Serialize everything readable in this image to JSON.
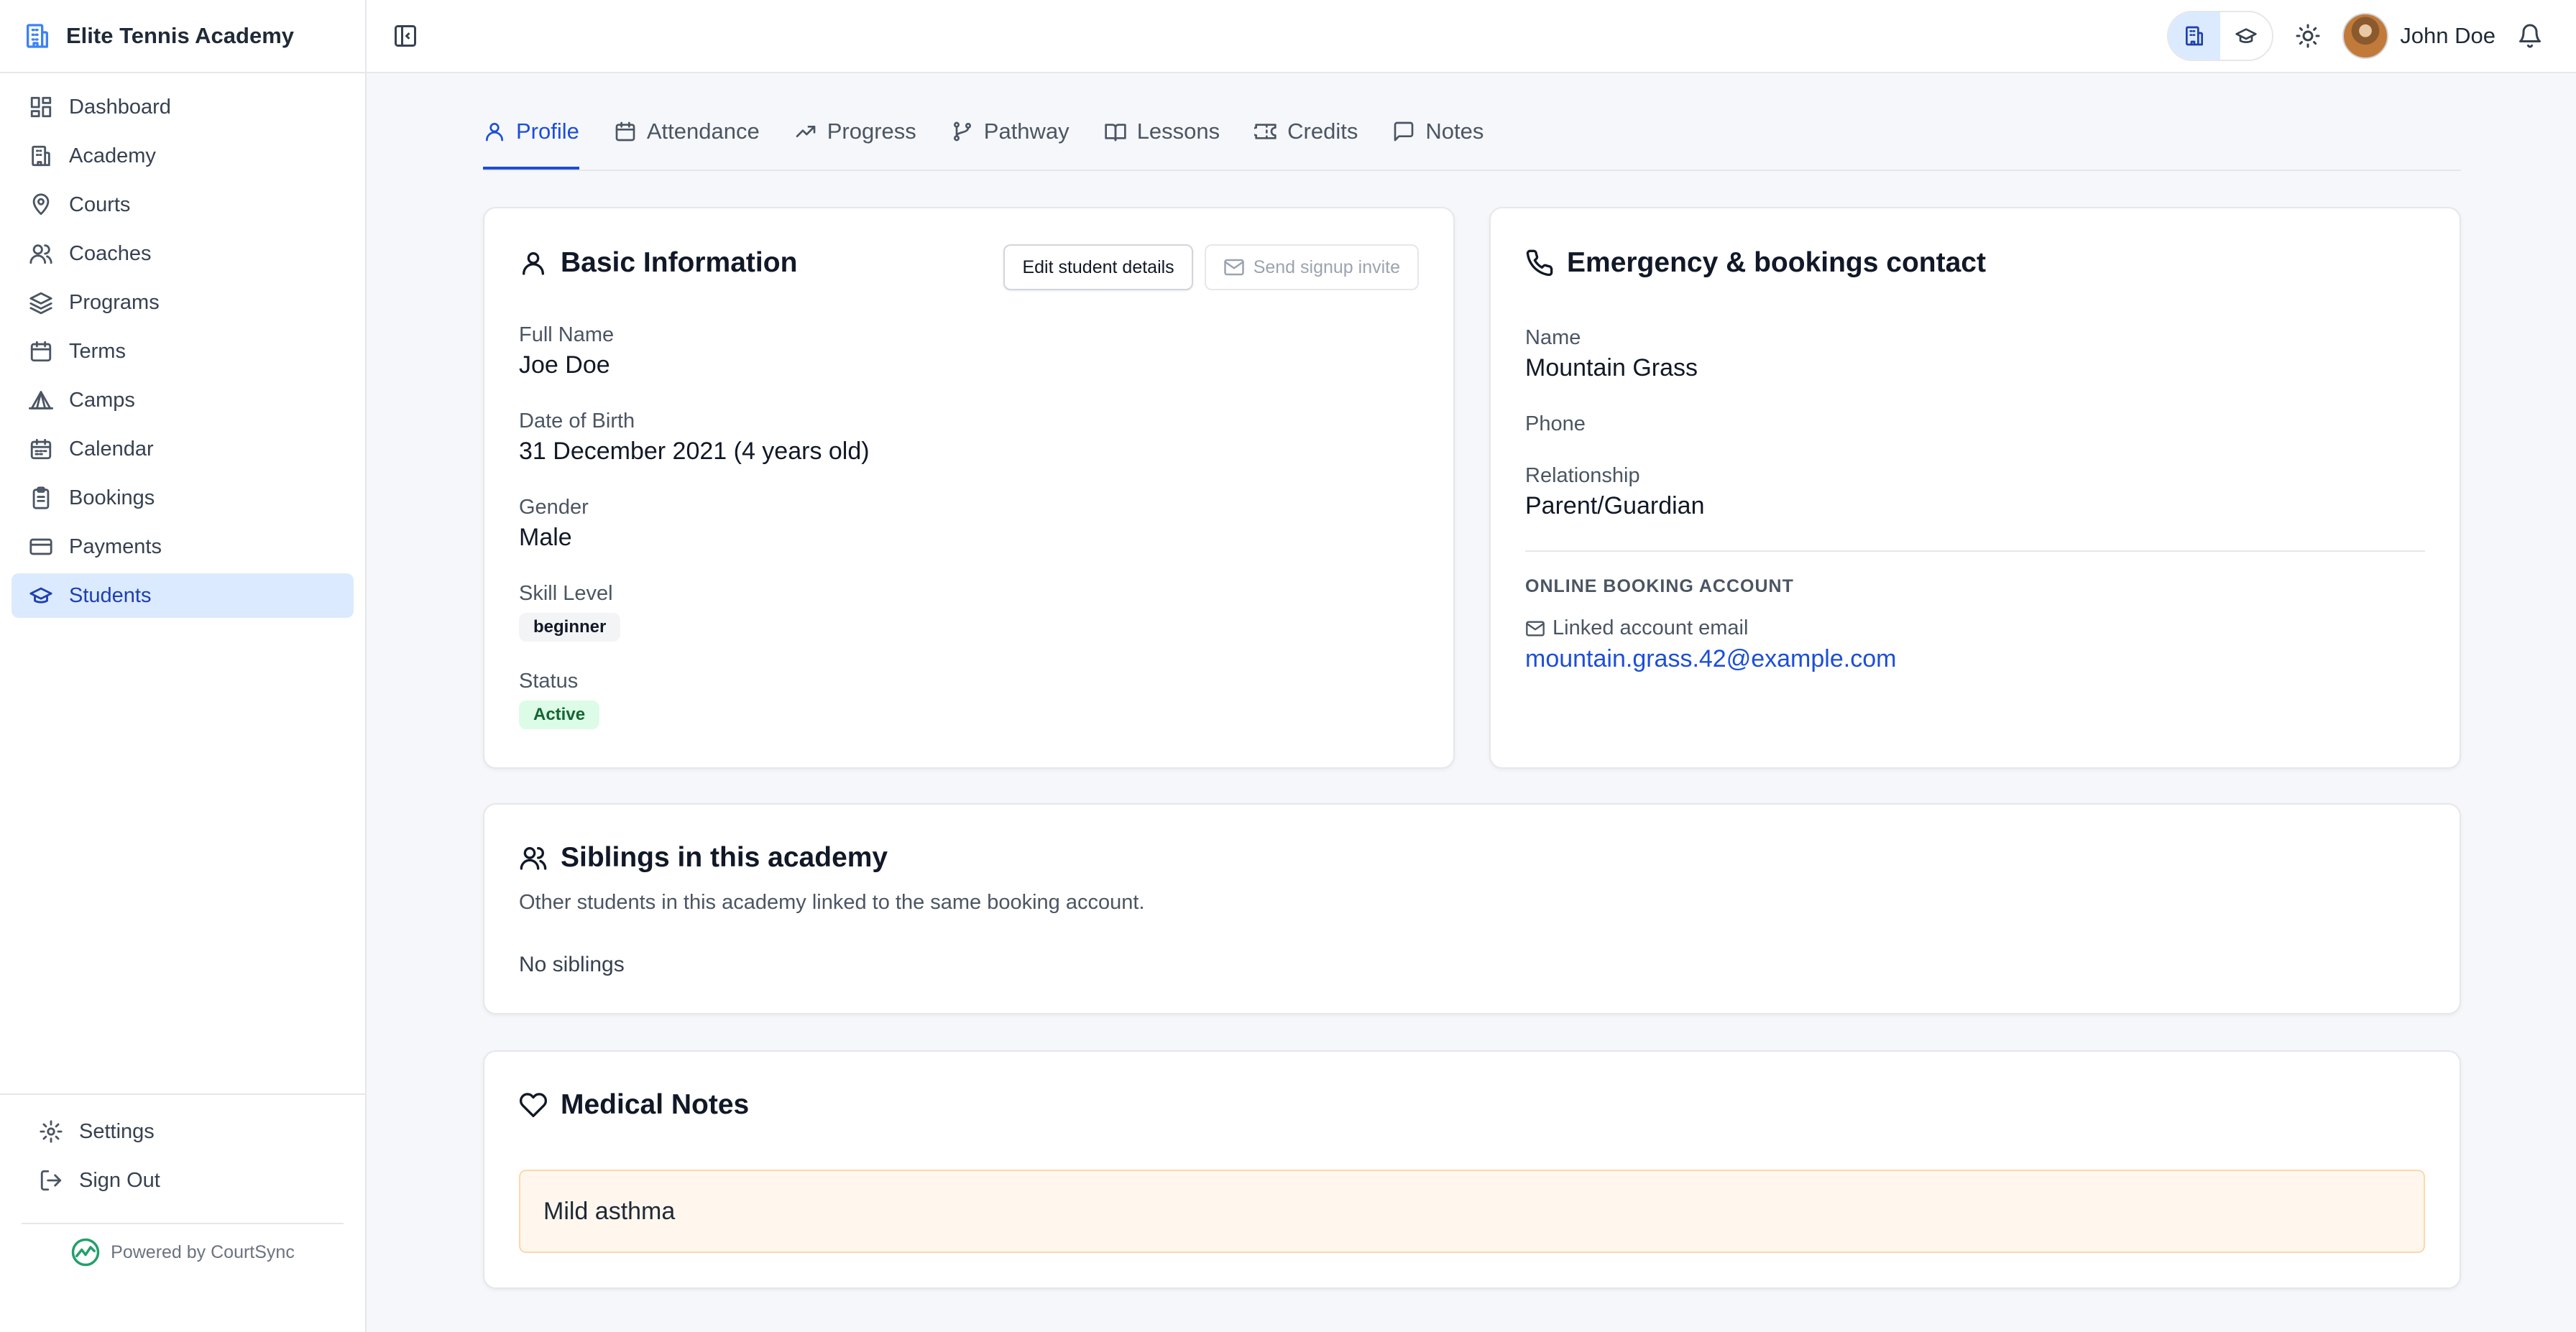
{
  "sidebar": {
    "brand": "Elite Tennis Academy",
    "items": [
      {
        "label": "Dashboard",
        "icon": "dashboard-icon"
      },
      {
        "label": "Academy",
        "icon": "building-icon"
      },
      {
        "label": "Courts",
        "icon": "map-pin-icon"
      },
      {
        "label": "Coaches",
        "icon": "users-icon"
      },
      {
        "label": "Programs",
        "icon": "layers-icon"
      },
      {
        "label": "Terms",
        "icon": "calendar-icon"
      },
      {
        "label": "Camps",
        "icon": "tent-icon"
      },
      {
        "label": "Calendar",
        "icon": "calendar-days-icon"
      },
      {
        "label": "Bookings",
        "icon": "clipboard-icon"
      },
      {
        "label": "Payments",
        "icon": "credit-card-icon"
      },
      {
        "label": "Students",
        "icon": "graduation-cap-icon",
        "active": true
      }
    ],
    "settings_label": "Settings",
    "signout_label": "Sign Out",
    "powered_by": "Powered by CourtSync"
  },
  "topbar": {
    "user_name": "John Doe"
  },
  "tabs": [
    {
      "label": "Profile",
      "active": true
    },
    {
      "label": "Attendance"
    },
    {
      "label": "Progress"
    },
    {
      "label": "Pathway"
    },
    {
      "label": "Lessons"
    },
    {
      "label": "Credits"
    },
    {
      "label": "Notes"
    }
  ],
  "basic": {
    "title": "Basic Information",
    "edit_label": "Edit student details",
    "invite_label": "Send signup invite",
    "full_name_label": "Full Name",
    "full_name": "Joe Doe",
    "dob_label": "Date of Birth",
    "dob": "31 December 2021 (4 years old)",
    "gender_label": "Gender",
    "gender": "Male",
    "skill_label": "Skill Level",
    "skill": "beginner",
    "status_label": "Status",
    "status": "Active"
  },
  "emergency": {
    "title": "Emergency & bookings contact",
    "name_label": "Name",
    "name": "Mountain Grass",
    "phone_label": "Phone",
    "relationship_label": "Relationship",
    "relationship": "Parent/Guardian",
    "account_caption": "ONLINE BOOKING ACCOUNT",
    "linked_label": "Linked account email",
    "email": "mountain.grass.42@example.com"
  },
  "siblings": {
    "title": "Siblings in this academy",
    "subtitle": "Other students in this academy linked to the same booking account.",
    "empty": "No siblings"
  },
  "medical": {
    "title": "Medical Notes",
    "note": "Mild asthma"
  },
  "colors": {
    "accent": "#1d4ed8",
    "active_nav_bg": "#dbeafe",
    "status_green_bg": "#dcfce7",
    "medical_bg": "#fff7ed"
  }
}
